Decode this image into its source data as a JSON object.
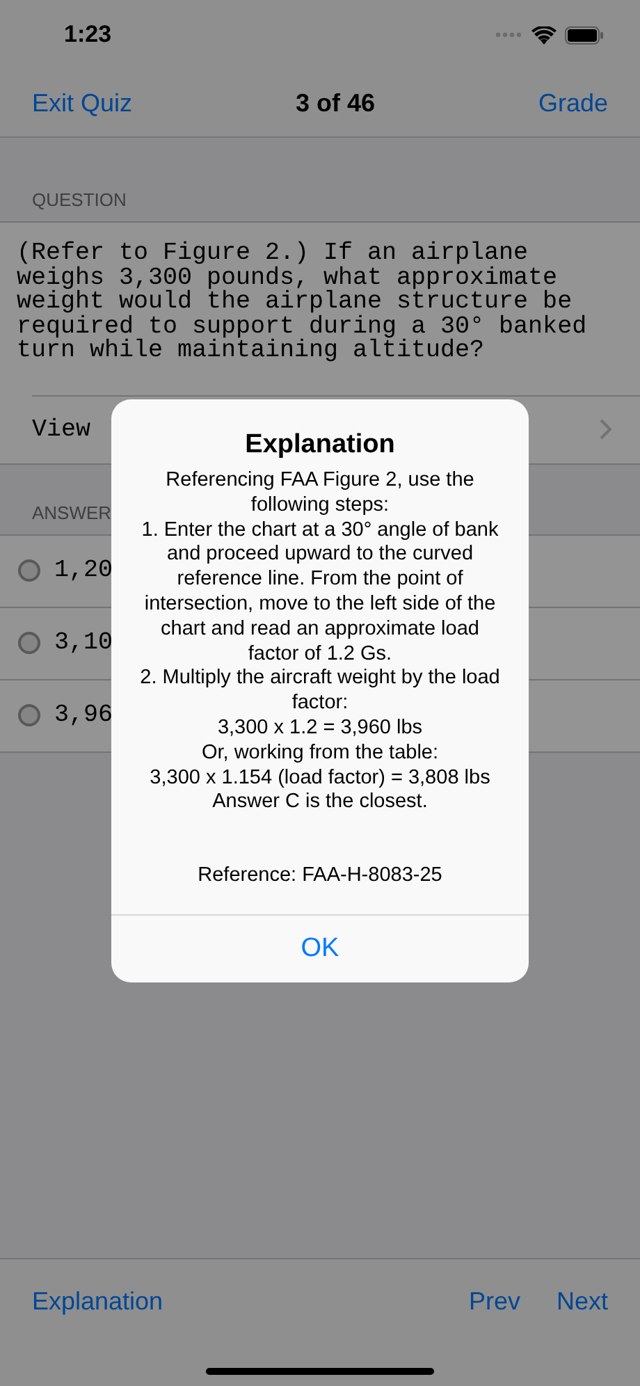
{
  "status_bar": {
    "time": "1:23"
  },
  "nav": {
    "left": "Exit Quiz",
    "title": "3 of 46",
    "right": "Grade"
  },
  "question": {
    "header": "QUESTION",
    "text": "(Refer to Figure 2.) If an airplane weighs 3,300 pounds, what approximate weight would the airplane structure be required to support during a 30° banked turn while maintaining altitude?",
    "link": "View"
  },
  "answers": {
    "header": "ANSWER",
    "options": [
      {
        "text": "1,20",
        "selected": false
      },
      {
        "text": "3,10",
        "selected": false
      },
      {
        "text": "3,96",
        "selected": false
      }
    ]
  },
  "alert": {
    "title": "Explanation",
    "paragraphs": [
      "Referencing FAA Figure 2, use the following steps:",
      "1. Enter the chart at a 30° angle of bank and proceed upward to the curved reference line. From the point of intersection, move to the left side of the chart and read an approximate load factor of 1.2 Gs.",
      "2. Multiply the aircraft weight by the load factor:",
      "3,300 x 1.2 = 3,960 lbs",
      "Or, working from the table:",
      "3,300 x 1.154 (load factor) = 3,808 lbs",
      "Answer C is the closest."
    ],
    "reference": "Reference: FAA-H-8083-25",
    "button": "OK"
  },
  "toolbar": {
    "left": "Explanation",
    "buttons": [
      "Prev",
      "Next"
    ]
  }
}
